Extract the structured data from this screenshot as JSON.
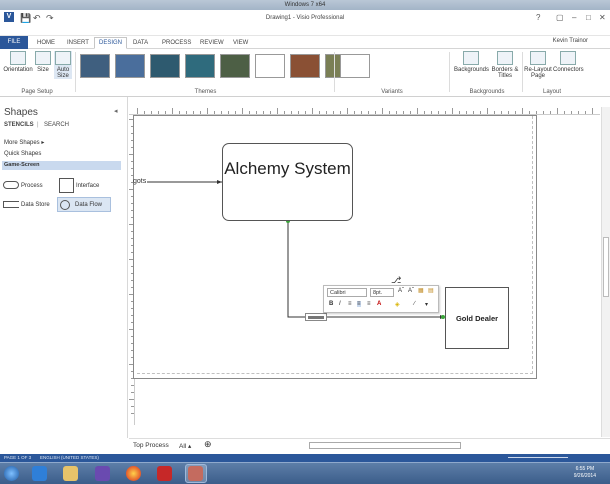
{
  "window": {
    "os_title": "Windows 7 x64",
    "doc_title": "Drawing1 - Visio Professional",
    "help": "?"
  },
  "ribbon_tabs": [
    "FILE",
    "HOME",
    "INSERT",
    "DESIGN",
    "DATA",
    "PROCESS",
    "REVIEW",
    "VIEW"
  ],
  "active_tab": "DESIGN",
  "user": "Kevin Trainor",
  "ribbon": {
    "page_setup": {
      "orientation": "Orientation",
      "size": "Size",
      "auto_size": "Auto Size",
      "label": "Page Setup"
    },
    "themes_label": "Themes",
    "variants_label": "Variants",
    "backgrounds": {
      "backgrounds": "Backgrounds",
      "borders": "Borders & Titles",
      "label": "Backgrounds"
    },
    "layout": {
      "relayout": "Re-Layout Page",
      "connectors": "Connectors",
      "label": "Layout"
    },
    "theme_colors": [
      "#3f5f7f",
      "#4a6e9c",
      "#2e5a6f",
      "#2f6b7d",
      "#4d5f45",
      "#ffffff",
      "#8a5034",
      "#7a7f55"
    ]
  },
  "shapes_panel": {
    "title": "Shapes",
    "stencils": "STENCILS",
    "search": "SEARCH",
    "more_shapes": "More Shapes",
    "quick_shapes": "Quick Shapes",
    "game_screen": "Game-Screen",
    "items": {
      "process": "Process",
      "interface": "Interface",
      "data_store": "Data Store",
      "data_flow": "Data Flow"
    }
  },
  "diagram": {
    "alchemy_system": "Alchemy System",
    "gold_dealer": "Gold Dealer",
    "incoming_label": "gots"
  },
  "mini_toolbar": {
    "font": "Calibri",
    "size": "8pt.",
    "bold": "B",
    "italic": "I"
  },
  "page_tabs": {
    "top_process": "Top Process",
    "all": "All ▴",
    "add": "⊕"
  },
  "status": {
    "page": "PAGE 1 OF 3",
    "language": "ENGLISH (UNITED STATES)"
  },
  "clock": {
    "time": "6:55 PM",
    "date": "9/26/2014"
  }
}
